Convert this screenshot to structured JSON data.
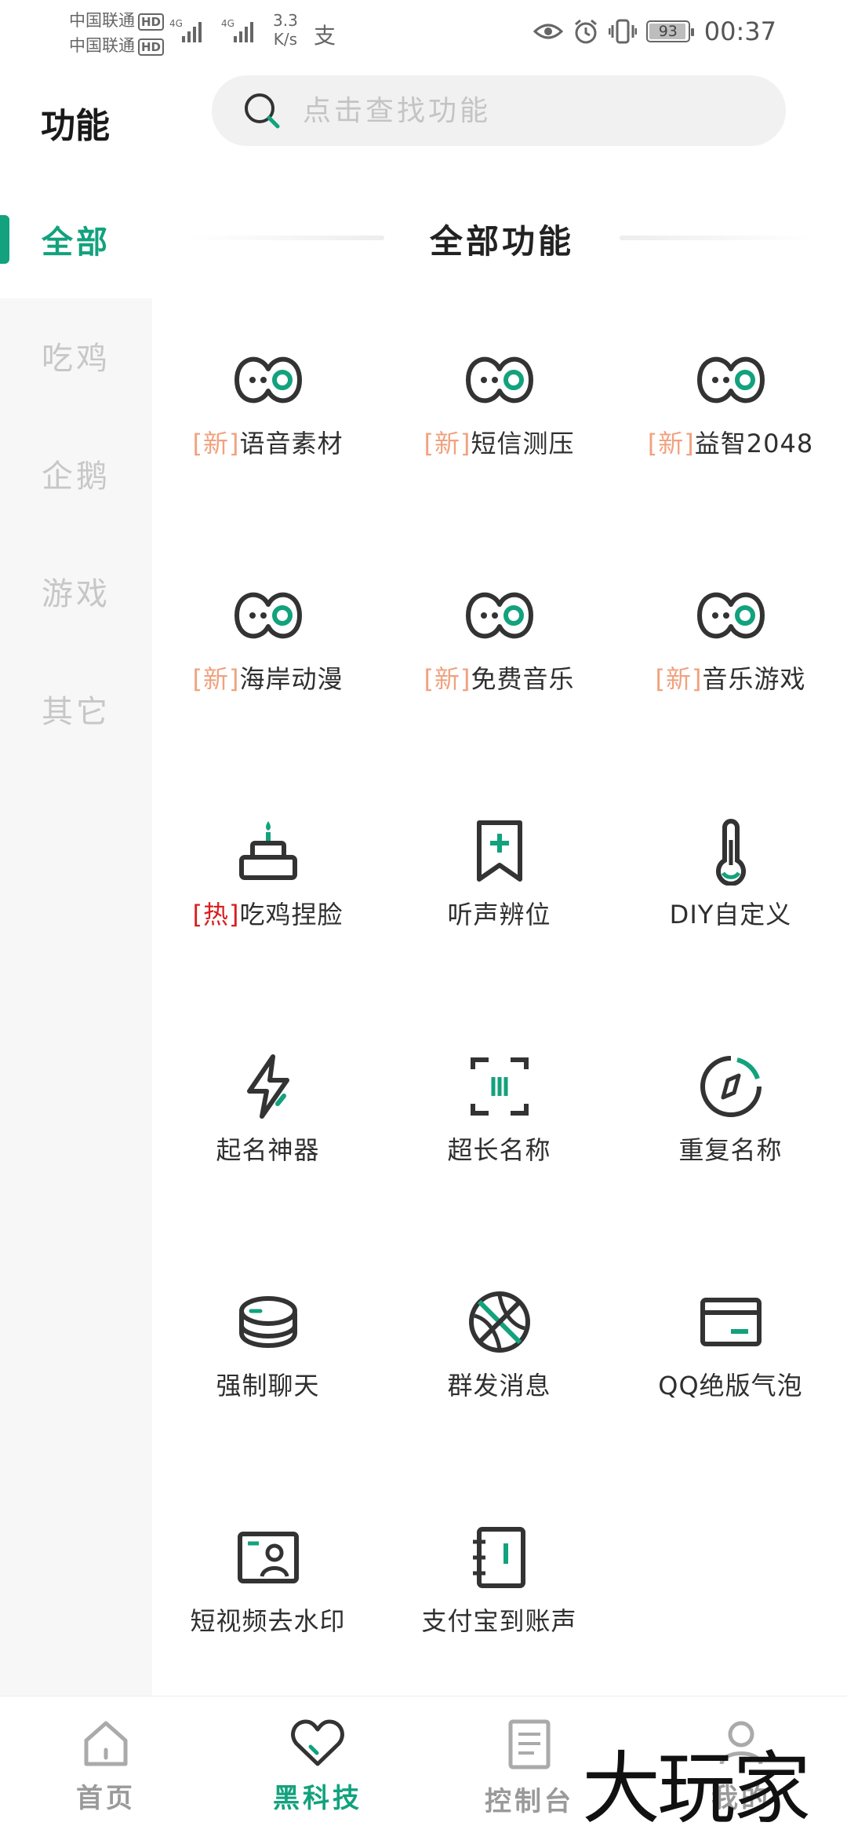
{
  "status_bar": {
    "carrier_1": "中国联通",
    "carrier_2": "中国联通",
    "hd_label": "HD",
    "net_label": "4G",
    "speed_value": "3.3",
    "speed_unit": "K/s",
    "alipay_glyph": "支",
    "battery": "93",
    "time": "00:37"
  },
  "header": {
    "title": "功能",
    "search_placeholder": "点击查找功能"
  },
  "sidebar": {
    "items": [
      {
        "label": "全部",
        "active": true
      },
      {
        "label": "吃鸡",
        "active": false
      },
      {
        "label": "企鹅",
        "active": false
      },
      {
        "label": "游戏",
        "active": false
      },
      {
        "label": "其它",
        "active": false
      }
    ]
  },
  "section": {
    "title": "全部功能"
  },
  "features": [
    {
      "tag": "[新]",
      "tag_type": "new",
      "name": "语音素材",
      "icon": "eyes-icon"
    },
    {
      "tag": "[新]",
      "tag_type": "new",
      "name": "短信测压",
      "icon": "eyes-icon"
    },
    {
      "tag": "[新]",
      "tag_type": "new",
      "name": "益智2048",
      "icon": "eyes-icon"
    },
    {
      "tag": "[新]",
      "tag_type": "new",
      "name": "海岸动漫",
      "icon": "eyes-icon"
    },
    {
      "tag": "[新]",
      "tag_type": "new",
      "name": "免费音乐",
      "icon": "eyes-icon"
    },
    {
      "tag": "[新]",
      "tag_type": "new",
      "name": "音乐游戏",
      "icon": "eyes-icon"
    },
    {
      "tag": "[热]",
      "tag_type": "hot",
      "name": "吃鸡捏脸",
      "icon": "cake-icon"
    },
    {
      "tag": "",
      "tag_type": "",
      "name": "听声辨位",
      "icon": "bookmark-plus-icon"
    },
    {
      "tag": "",
      "tag_type": "",
      "name": "DIY自定义",
      "icon": "thermometer-icon"
    },
    {
      "tag": "",
      "tag_type": "",
      "name": "起名神器",
      "icon": "lightning-icon"
    },
    {
      "tag": "",
      "tag_type": "",
      "name": "超长名称",
      "icon": "scan-icon"
    },
    {
      "tag": "",
      "tag_type": "",
      "name": "重复名称",
      "icon": "compass-icon"
    },
    {
      "tag": "",
      "tag_type": "",
      "name": "强制聊天",
      "icon": "coins-icon"
    },
    {
      "tag": "",
      "tag_type": "",
      "name": "群发消息",
      "icon": "basketball-icon"
    },
    {
      "tag": "",
      "tag_type": "",
      "name": "QQ绝版气泡",
      "icon": "card-icon"
    },
    {
      "tag": "",
      "tag_type": "",
      "name": "短视频去水印",
      "icon": "id-card-icon"
    },
    {
      "tag": "",
      "tag_type": "",
      "name": "支付宝到账声",
      "icon": "notebook-icon"
    }
  ],
  "bottom_nav": [
    {
      "label": "首页",
      "icon": "home-icon",
      "active": false
    },
    {
      "label": "黑科技",
      "icon": "heart-icon",
      "active": true
    },
    {
      "label": "控制台",
      "icon": "document-icon",
      "active": false
    },
    {
      "label": "我的",
      "icon": "user-icon",
      "active": false
    }
  ],
  "watermark": "大玩家",
  "colors": {
    "accent": "#12a27d",
    "tag_new": "#f0a27f",
    "tag_hot": "#d81e1e",
    "icon_stroke": "#333333",
    "sidebar_bg": "#f7f7f8",
    "inactive_text": "#c7c7c7"
  }
}
